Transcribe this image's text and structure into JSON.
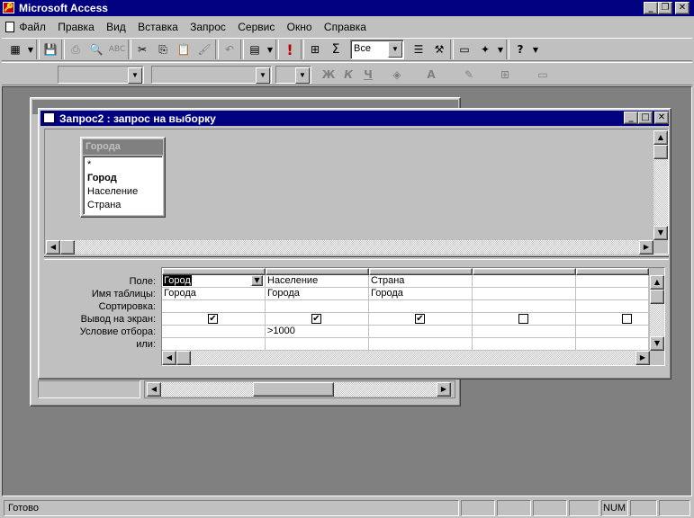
{
  "app": {
    "title": "Microsoft Access"
  },
  "menu": [
    "Файл",
    "Правка",
    "Вид",
    "Вставка",
    "Запрос",
    "Сервис",
    "Окно",
    "Справка"
  ],
  "toolbar": {
    "top_values": "Все",
    "sigma": "Σ",
    "exclaim": "!"
  },
  "format_toolbar": {
    "bold": "Ж",
    "italic": "К",
    "underline": "Ч"
  },
  "query_window": {
    "title": "Запрос2 : запрос на выборку"
  },
  "table_box": {
    "title": "Города",
    "fields": [
      "*",
      "Город",
      "Население",
      "Страна"
    ]
  },
  "grid": {
    "row_labels": [
      "Поле:",
      "Имя таблицы:",
      "Сортировка:",
      "Вывод на экран:",
      "Условие отбора:",
      "или:"
    ],
    "columns": [
      {
        "field": "Город",
        "table": "Города",
        "sort": "",
        "show": true,
        "criteria": "",
        "or": ""
      },
      {
        "field": "Население",
        "table": "Города",
        "sort": "",
        "show": true,
        "criteria": ">1000",
        "or": ""
      },
      {
        "field": "Страна",
        "table": "Города",
        "sort": "",
        "show": true,
        "criteria": "",
        "or": ""
      },
      {
        "field": "",
        "table": "",
        "sort": "",
        "show": false,
        "criteria": "",
        "or": ""
      },
      {
        "field": "",
        "table": "",
        "sort": "",
        "show": false,
        "criteria": "",
        "or": ""
      }
    ]
  },
  "status": {
    "text": "Готово",
    "num": "NUM"
  }
}
